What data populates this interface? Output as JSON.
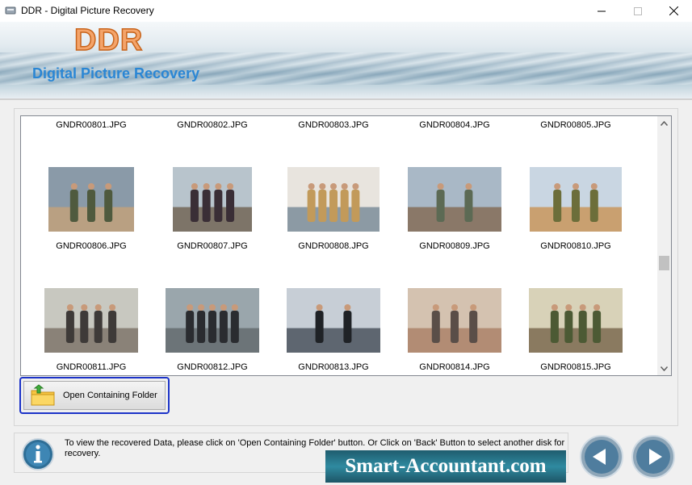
{
  "window": {
    "title": "DDR - Digital Picture Recovery",
    "icon": "app-drive-icon",
    "controls": {
      "minimize_icon": "minimize-icon",
      "maximize_icon": "maximize-icon",
      "close_icon": "close-icon"
    }
  },
  "banner": {
    "logo": "DDR",
    "subtitle": "Digital Picture Recovery",
    "colors": {
      "logo_fill": "#f4a46a",
      "logo_stroke": "#c8641c",
      "subtitle": "#2a86d4"
    }
  },
  "gallery": {
    "items": [
      {
        "name": "GNDR00801.JPG",
        "has_thumbnail": false
      },
      {
        "name": "GNDR00802.JPG",
        "has_thumbnail": false
      },
      {
        "name": "GNDR00803.JPG",
        "has_thumbnail": false
      },
      {
        "name": "GNDR00804.JPG",
        "has_thumbnail": false
      },
      {
        "name": "GNDR00805.JPG",
        "has_thumbnail": false
      },
      {
        "name": "GNDR00806.JPG",
        "has_thumbnail": true,
        "palette": [
          "#8a9aa8",
          "#4f5a3e",
          "#b9a082"
        ]
      },
      {
        "name": "GNDR00807.JPG",
        "has_thumbnail": true,
        "palette": [
          "#b8c4cc",
          "#3a2e36",
          "#7d7468"
        ]
      },
      {
        "name": "GNDR00808.JPG",
        "has_thumbnail": true,
        "palette": [
          "#e8e4de",
          "#c29a5a",
          "#8c9aa4"
        ]
      },
      {
        "name": "GNDR00809.JPG",
        "has_thumbnail": true,
        "palette": [
          "#a9b8c6",
          "#5c6a54",
          "#8a7868"
        ]
      },
      {
        "name": "GNDR00810.JPG",
        "has_thumbnail": true,
        "palette": [
          "#c9d6e2",
          "#6c6e3a",
          "#c9a070"
        ]
      },
      {
        "name": "GNDR00811.JPG",
        "has_thumbnail": true,
        "palette": [
          "#c8c8c0",
          "#3e3a38",
          "#8a8278"
        ]
      },
      {
        "name": "GNDR00812.JPG",
        "has_thumbnail": true,
        "palette": [
          "#9aa6ac",
          "#2a2c30",
          "#6c7478"
        ]
      },
      {
        "name": "GNDR00813.JPG",
        "has_thumbnail": true,
        "palette": [
          "#c7ced6",
          "#1f2226",
          "#5e6670"
        ]
      },
      {
        "name": "GNDR00814.JPG",
        "has_thumbnail": true,
        "palette": [
          "#d4c2b0",
          "#5a4e48",
          "#b28c74"
        ]
      },
      {
        "name": "GNDR00815.JPG",
        "has_thumbnail": true,
        "palette": [
          "#d8d2b8",
          "#4c5a34",
          "#8a7a60"
        ]
      }
    ],
    "scroll_position": 0.56
  },
  "open_folder_button": {
    "label": "Open Containing Folder",
    "icon": "folder-up-icon"
  },
  "info": {
    "icon": "info-icon",
    "text": "To view the recovered Data, please click on 'Open Containing Folder' button. Or Click on 'Back' Button to select another disk for recovery."
  },
  "watermark": {
    "text": "Smart-Accountant.com"
  },
  "nav": {
    "back_icon": "back-arrow-icon",
    "next_icon": "next-arrow-icon"
  }
}
